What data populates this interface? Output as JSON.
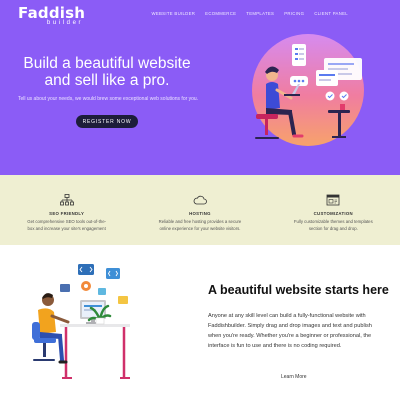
{
  "header": {
    "logo_main": "Faddish",
    "logo_sub": "builder",
    "nav": [
      "WEBSITE BUILDER",
      "ECOMMERCE",
      "TEMPLATES",
      "PRICING",
      "CLIENT PANEL"
    ]
  },
  "hero": {
    "title": "Build a beautiful website and sell like a pro.",
    "text": "Tell us about your needs, we would brew some exceptional web solutions for you.",
    "button": "REGISTER NOW"
  },
  "features": [
    {
      "icon": "sitemap-icon",
      "title": "SEO FRIENDLY",
      "desc": "Get comprehensive SEO tools out-of-the-box and increase your site's engagement"
    },
    {
      "icon": "cloud-icon",
      "title": "HOSTING",
      "desc": "Reliable and free hosting provides a secure online experience for your website visitors."
    },
    {
      "icon": "browser-window-icon",
      "title": "CUSTOMIZATION",
      "desc": "Fully customizable themes and templates section for drag and drop."
    }
  ],
  "builder": {
    "title": "A beautiful website starts here",
    "text": "Anyone at any skill level can build a fully-functional website with Faddishbuilder. Simply drag and drop images and text and publish when you're ready. Whether you're a beginner or professional, the interface is fun to use and there is no coding required.",
    "link": "Learn More"
  },
  "colors": {
    "hero_bg": "#8b5cf6",
    "features_bg": "#efefd2",
    "button_bg": "#1d1d3a"
  }
}
